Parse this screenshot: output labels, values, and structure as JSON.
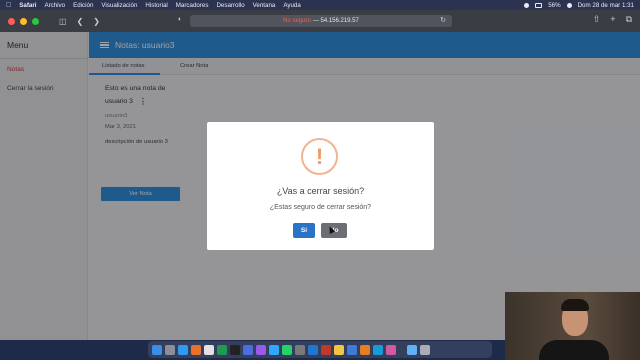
{
  "menubar": {
    "app": "Safari",
    "items": [
      "Archivo",
      "Edición",
      "Visualización",
      "Historial",
      "Marcadores",
      "Desarrollo",
      "Ventana",
      "Ayuda"
    ],
    "battery": "56%",
    "clock": "Dom 28 de mar  1:31"
  },
  "browser": {
    "url_warning": "No seguro",
    "url_host": "— 54.156.219.57"
  },
  "sidebar": {
    "title": "Menu",
    "items": [
      {
        "label": "Notas",
        "active": true
      },
      {
        "label": "Cerrar la sesión",
        "active": false
      }
    ]
  },
  "appbar": {
    "title": "Notas: usuario3",
    "color": "#1e86d6"
  },
  "tabs": [
    {
      "label": "Listado de notas",
      "active": true
    },
    {
      "label": "Crear Nota",
      "active": false
    }
  ],
  "note": {
    "title": "Esto es una nota de usuario 3",
    "user": "usuario3",
    "date": "Mar 3, 2021",
    "description": "descripción de usuario 3",
    "button": "Ver Nota"
  },
  "dialog": {
    "icon": "!",
    "title": "¿Vas a cerrar sesión?",
    "text": "¿Estas seguro de cerrar sesión?",
    "confirm": "Si",
    "cancel": "No",
    "confirm_color": "#2b73c7",
    "cancel_color": "#6b6e73"
  }
}
